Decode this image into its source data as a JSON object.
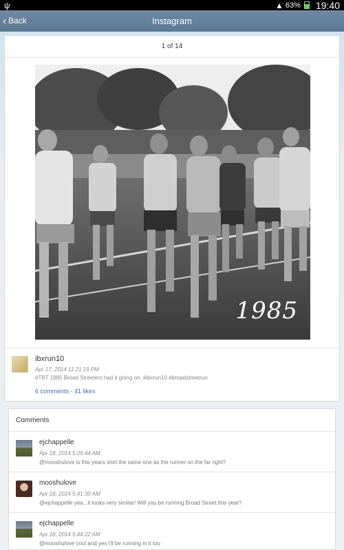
{
  "status_bar": {
    "battery_pct": "63%",
    "clock": "19:40"
  },
  "header": {
    "back_label": "Back",
    "title": "Instagram"
  },
  "post": {
    "counter": "1 of 14",
    "photo_overlay": "1985",
    "username": "ibxrun10",
    "timestamp": "Apr 17, 2014 11:21:19 PM",
    "caption": "#TBT 1985 Broad Streeters had it going on. #ibxrun10 #broadstreetrun",
    "comments_link": "6 comments",
    "separator": " - ",
    "likes_link": "41 likes"
  },
  "comments": {
    "heading": "Comments",
    "items": [
      {
        "user": "ejchappelle",
        "time": "Apr 18, 2014 5:25:44 AM",
        "text": "@mooshulove is this years shirt the same one as the runner on the far right?",
        "avatar": "runner"
      },
      {
        "user": "mooshulove",
        "time": "Apr 18, 2014 5:41:30 AM",
        "text": "@ejchappelle yea...it looks very similar! Will you be running Broad Street this year?",
        "avatar": "woman"
      },
      {
        "user": "ejchappelle",
        "time": "Apr 18, 2014 5:44:22 AM",
        "text": "@mooshulove cool and yes I'll be running in it too",
        "avatar": "runner"
      }
    ]
  }
}
